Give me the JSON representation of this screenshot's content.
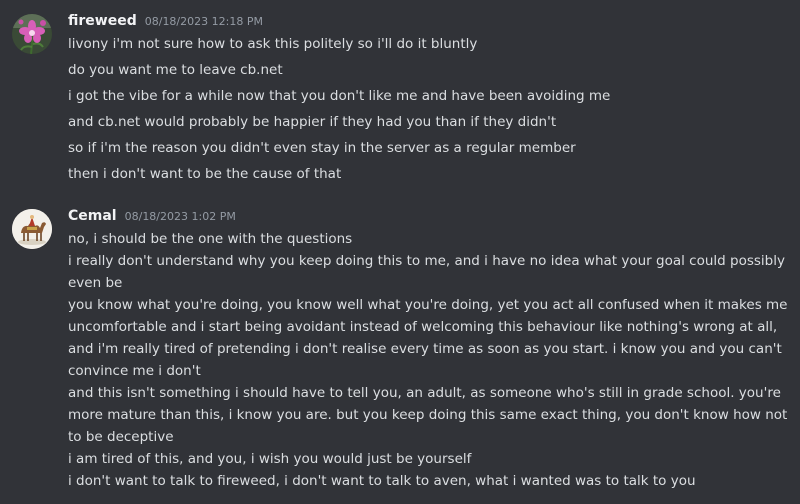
{
  "messages": [
    {
      "username": "fireweed",
      "timestamp": "08/18/2023 12:18 PM",
      "avatar_icon": "pink-flower-avatar-icon",
      "lines": [
        "livony i'm not sure how to ask this politely so i'll do it bluntly",
        "do you want me to leave cb.net",
        "i got the vibe for a while now that you don't like me and have been avoiding me",
        "and cb.net would probably be happier if they had you than if they didn't",
        "so if i'm the reason you didn't even stay in the server as a regular member",
        "then i don't want to be the cause of that"
      ]
    },
    {
      "username": "Cemal",
      "timestamp": "08/18/2023 1:02 PM",
      "avatar_icon": "camel-avatar-icon",
      "lines": [
        "no, i should be the one with the questions",
        "i really don't understand why you keep doing this to me, and i have no idea what your goal could possibly even be",
        "you know what you're doing, you know well what you're doing, yet you act all confused when it makes me uncomfortable and i start being avoidant instead of welcoming this behaviour like nothing's wrong at all, and i'm really tired of pretending i don't realise every time as soon as you start. i know you and you can't convince me i don't",
        "and this isn't something i should have to tell you, an adult, as someone who's still in grade school. you're more mature than this, i know you are. but you keep doing this same exact thing, you don't know how not to be deceptive",
        "i am tired of this, and you, i wish you would just be yourself",
        "i don't want to talk to fireweed, i don't want to talk to aven, what i wanted was to talk to you"
      ]
    }
  ]
}
